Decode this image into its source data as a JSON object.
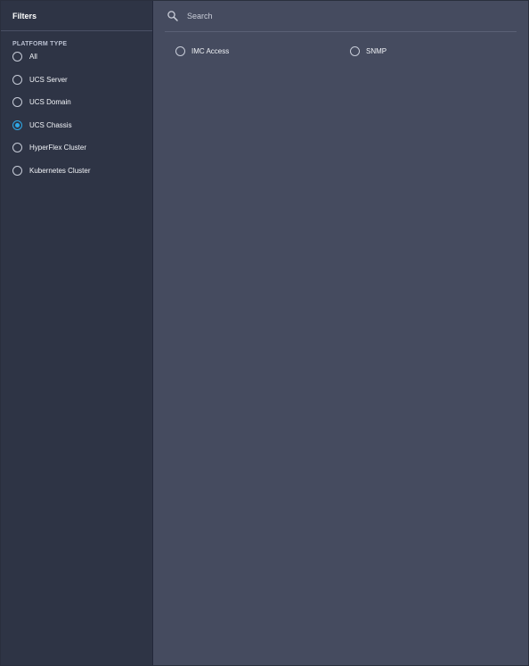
{
  "sidebar": {
    "title": "Filters",
    "section_title": "PLATFORM TYPE",
    "items": [
      {
        "label": "All",
        "checked": false
      },
      {
        "label": "UCS Server",
        "checked": false
      },
      {
        "label": "UCS Domain",
        "checked": false
      },
      {
        "label": "UCS Chassis",
        "checked": true
      },
      {
        "label": "HyperFlex Cluster",
        "checked": false
      },
      {
        "label": "Kubernetes Cluster",
        "checked": false
      }
    ]
  },
  "search": {
    "placeholder": "Search",
    "value": ""
  },
  "options": [
    {
      "label": "IMC Access",
      "checked": false
    },
    {
      "label": "SNMP",
      "checked": false
    }
  ],
  "colors": {
    "accent": "#2ea8e6",
    "sidebar_bg": "#2e3445",
    "main_bg": "#454b5f"
  }
}
